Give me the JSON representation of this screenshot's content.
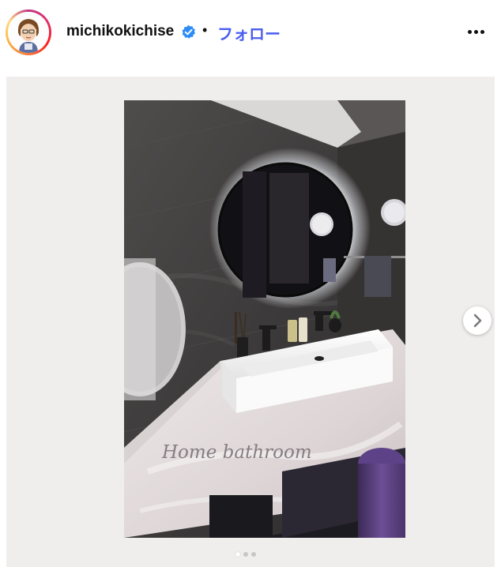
{
  "post": {
    "username": "michikokichise",
    "verified": true,
    "separator": "•",
    "follow_label": "フォロー",
    "more_icon": "more-horizontal-icon"
  },
  "media": {
    "image_text": "Home bathroom",
    "next_icon": "chevron-right-icon",
    "carousel": {
      "count": 3,
      "active_index": 0
    }
  },
  "colors": {
    "follow": "#4a5df0",
    "verified": "#2f8cf4",
    "background": "#f0eeed",
    "active_dot": "#ffffff",
    "inactive_dot": "#c9c7c6"
  }
}
